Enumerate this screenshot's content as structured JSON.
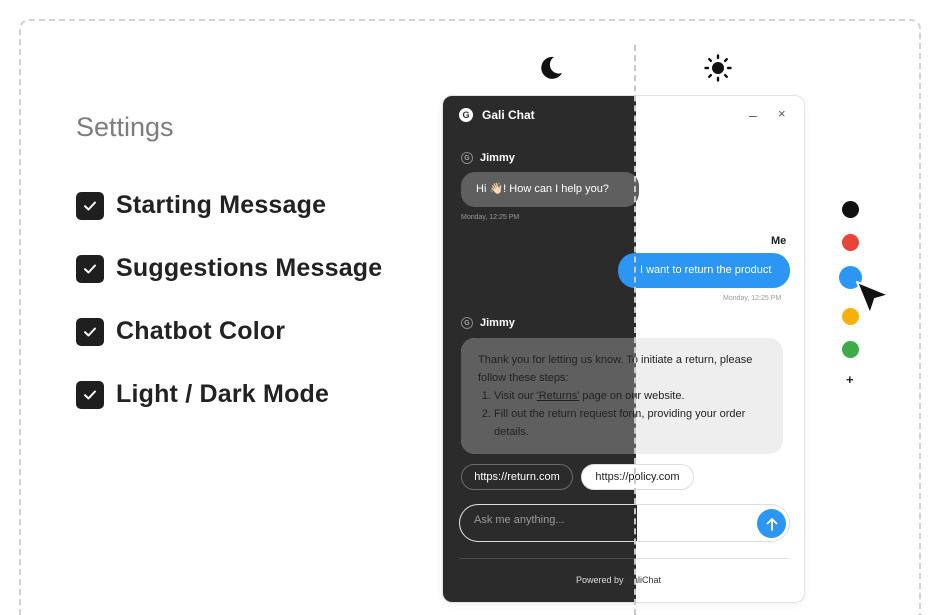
{
  "settings": {
    "title": "Settings",
    "options": [
      {
        "label": "Starting Message",
        "checked": true
      },
      {
        "label": "Suggestions Message",
        "checked": true
      },
      {
        "label": "Chatbot Color",
        "checked": true
      },
      {
        "label": "Light / Dark Mode",
        "checked": true
      }
    ]
  },
  "theme": {
    "dark_icon": "moon-icon",
    "light_icon": "sun-icon"
  },
  "chat": {
    "brand_logo": "G",
    "title": "Gali Chat",
    "controls": {
      "minimize": "–",
      "close": "×"
    },
    "messages": [
      {
        "sender": "Jimmy",
        "avatar": "G",
        "text": "Hi 👋🏻! How can I help you?",
        "time": "Monday, 12:25 PM"
      },
      {
        "sender": "Me",
        "text": "I want to return the product",
        "time": "Monday, 12:25 PM"
      },
      {
        "sender": "Jimmy",
        "avatar": "G",
        "intro": "Thank you for letting us know. To initiate a return, please follow these steps:",
        "step1_before": "Visit our ",
        "step1_link": "'Returns'",
        "step1_after": " page on our website.",
        "step2": "Fill out the return request form, providing your order details."
      }
    ],
    "suggestions": [
      "https://return.com",
      "https://policy.com"
    ],
    "input_placeholder": "Ask me anything...",
    "footer_prefix": "Powered by ",
    "footer_brand": "GaliChat"
  },
  "palette": {
    "colors": [
      "#111111",
      "#e9443a",
      "#2b96f3",
      "#f5b10a",
      "#3dab48"
    ],
    "selected_index": 2,
    "add_label": "+"
  }
}
